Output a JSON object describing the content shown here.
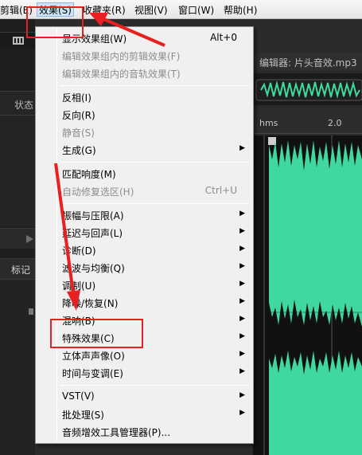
{
  "menubar": {
    "items": [
      {
        "label": "剪辑(E)"
      },
      {
        "label": "效果(S)"
      },
      {
        "label": "收藏夹(R)"
      },
      {
        "label": "视图(V)"
      },
      {
        "label": "窗口(W)"
      },
      {
        "label": "帮助(H)"
      }
    ]
  },
  "left_panel": {
    "status_label": "状态",
    "markers_tab": "标记",
    "play_icon": "play-icon"
  },
  "editor": {
    "title": "编辑器: 片头音效.mp3",
    "ruler": {
      "start": "hms",
      "mark": "2.0"
    }
  },
  "effects_menu": {
    "items": [
      {
        "label": "显示效果组(W)",
        "shortcut": "Alt+0",
        "disabled": false
      },
      {
        "label": "编辑效果组内的剪辑效果(F)",
        "disabled": true
      },
      {
        "label": "编辑效果组内的音轨效果(T)",
        "disabled": true
      },
      {
        "label": "反相(I)",
        "disabled": false
      },
      {
        "label": "反向(R)",
        "disabled": false
      },
      {
        "label": "静音(S)",
        "disabled": true
      },
      {
        "label": "生成(G)",
        "submenu": true
      },
      {
        "label": "匹配响度(M)",
        "disabled": false
      },
      {
        "label": "自动修复选区(H)",
        "shortcut": "Ctrl+U",
        "disabled": true
      },
      {
        "label": "振幅与压限(A)",
        "submenu": true
      },
      {
        "label": "延迟与回声(L)",
        "submenu": true
      },
      {
        "label": "诊断(D)",
        "submenu": true
      },
      {
        "label": "滤波与均衡(Q)",
        "submenu": true
      },
      {
        "label": "调制(U)",
        "submenu": true
      },
      {
        "label": "降噪/恢复(N)",
        "submenu": true
      },
      {
        "label": "混响(B)",
        "submenu": true
      },
      {
        "label": "特殊效果(C)",
        "submenu": true
      },
      {
        "label": "立体声声像(O)",
        "submenu": true
      },
      {
        "label": "时间与变调(E)",
        "submenu": true
      },
      {
        "label": "VST(V)",
        "submenu": true
      },
      {
        "label": "批处理(S)",
        "submenu": true
      },
      {
        "label": "音频增效工具管理器(P)..."
      }
    ]
  },
  "colors": {
    "waveform": "#3fd9a0",
    "annotation": "#e8201f"
  }
}
